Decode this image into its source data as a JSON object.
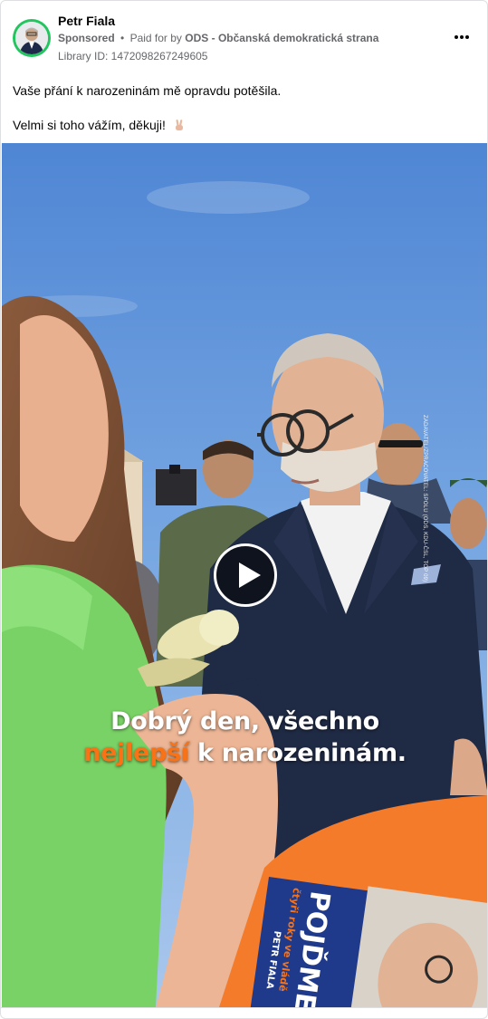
{
  "post": {
    "author": "Petr Fiala",
    "sponsored_label": "Sponsored",
    "separator": "•",
    "paid_for_prefix": "Paid for by",
    "payer": "ODS - Občanská demokratická strana",
    "library_id": "Library ID: 1472098267249605",
    "text_line1": "Vaše přání k narozeninám mě opravdu potěšila.",
    "text_line2": "Velmi si toho vážím, děkuji!",
    "emoji_icon": "victory-hand-icon",
    "more_icon": "more-options-icon"
  },
  "video": {
    "subtitle_line1": "Dobrý den, všechno",
    "subtitle_line2_highlight": "nejlepší",
    "subtitle_line2_rest": " k narozeninám.",
    "watermark": "ZADAVATEL/ZPRACOVATEL: SPOLU (ODS, KDU-ČSL, TOP 09)",
    "poster_heading": "POJĎME",
    "poster_sub": "čtyři roky ve vládě",
    "poster_name": "PETR FIALA",
    "play_icon": "play-icon"
  },
  "colors": {
    "avatar_ring": "#22c55e",
    "subtitle_highlight": "#f97316",
    "table_orange": "#f47b2a",
    "poster_blue": "#1f3a8a"
  }
}
